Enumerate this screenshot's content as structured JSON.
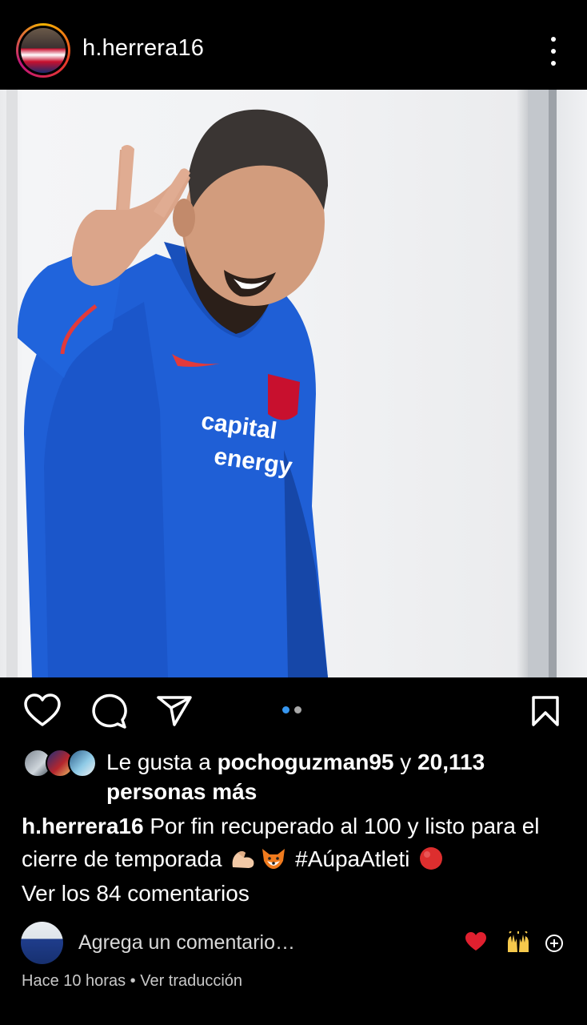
{
  "post": {
    "username": "h.herrera16",
    "photo_alt": "Photo",
    "carousel": {
      "total": 2,
      "active": 0,
      "active_color": "#3797f0",
      "inactive_color": "#a8a8a8"
    }
  },
  "actions": {
    "like_icon": "heart-outline-icon",
    "comment_icon": "comment-bubble-icon",
    "share_icon": "paper-plane-icon",
    "save_icon": "bookmark-icon"
  },
  "likes": {
    "prefix": "Le gusta a ",
    "user": "pochoguzman95",
    "middle": " y ",
    "count": "20,113",
    "suffix": "personas más"
  },
  "caption": {
    "username": "h.herrera16",
    "text": " Por fin recuperado al 100 y listo para el cierre de temporada ",
    "hashtag": "#AúpaAtleti",
    "emojis": [
      "flexed-biceps-icon",
      "fox-icon",
      "red-circle-icon"
    ]
  },
  "comments": {
    "view_all": "Ver los 84 comentarios",
    "placeholder": "Agrega un comentario…",
    "quick_reactions": [
      "red-heart-icon",
      "raising-hands-icon",
      "add-circle-icon"
    ]
  },
  "footer": {
    "time": "Hace 10 horas",
    "separator": " • ",
    "translate": "Ver traducción"
  }
}
